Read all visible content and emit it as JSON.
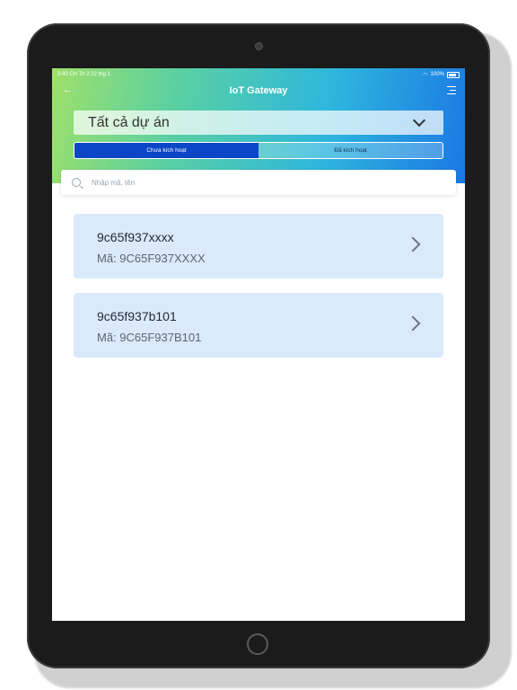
{
  "status_bar": {
    "time": "3:40 CH  Th 2 22 thg 1",
    "battery": "100%"
  },
  "header": {
    "title": "IoT Gateway"
  },
  "project_select": {
    "label": "Tất cả dự án"
  },
  "tabs": [
    {
      "label": "Chưa kích hoạt",
      "active": true
    },
    {
      "label": "Đã kích hoạt",
      "active": false
    }
  ],
  "search": {
    "placeholder": "Nhập mã, tên",
    "value": ""
  },
  "devices": [
    {
      "name": "9c65f937xxxx",
      "code": "Mã: 9C65F937XXXX"
    },
    {
      "name": "9c65f937b101",
      "code": "Mã: 9C65F937B101"
    }
  ],
  "icons": [
    "back-arrow-icon",
    "menu-icon",
    "chevron-down-icon",
    "search-icon",
    "chevron-right-icon",
    "wifi-icon",
    "battery-icon"
  ]
}
